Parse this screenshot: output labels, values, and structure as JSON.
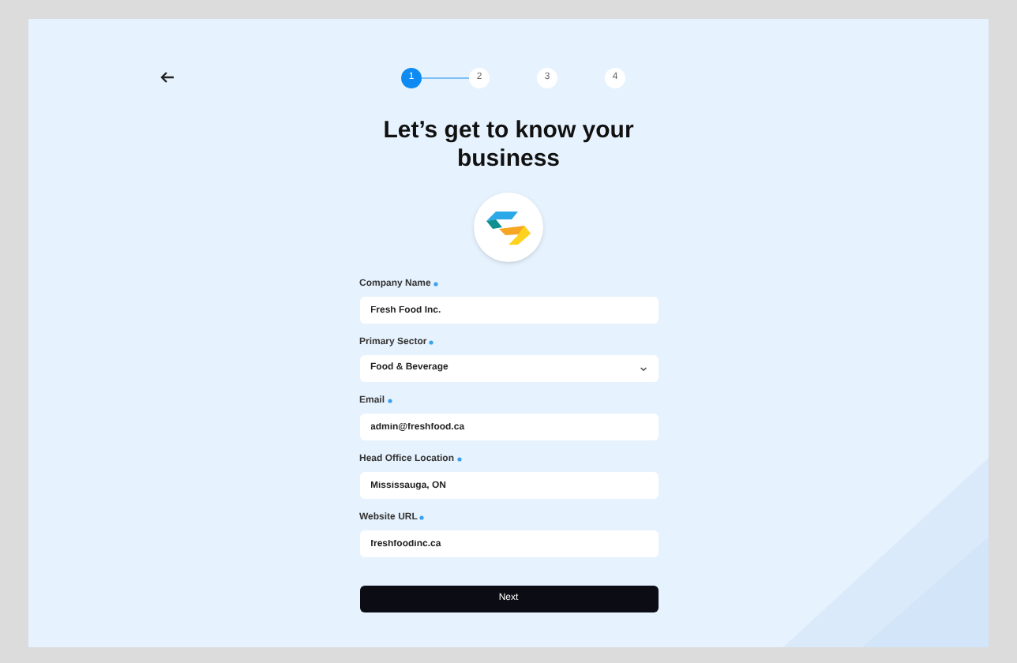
{
  "steps": [
    {
      "label": "1",
      "selected": true
    },
    {
      "label": "2",
      "selected": false
    },
    {
      "label": "3",
      "selected": false
    },
    {
      "label": "4",
      "selected": false
    }
  ],
  "title": "Let’s get to know your business",
  "fields": [
    {
      "kind": "text",
      "label": "Company Name",
      "required": true,
      "value": "Fresh Food Inc."
    },
    {
      "kind": "select",
      "label": "Primary Sector",
      "required": true,
      "value": "Food & Beverage"
    },
    {
      "kind": "text",
      "label": "Email",
      "required": true,
      "value": "admin@freshfood.ca"
    },
    {
      "kind": "text",
      "label": "Head Office Location",
      "required": true,
      "value": "Mississauga, ON"
    },
    {
      "kind": "text",
      "label": "Website URL",
      "required": true,
      "value": "freshfoodinc.ca"
    }
  ],
  "submit": "Next"
}
